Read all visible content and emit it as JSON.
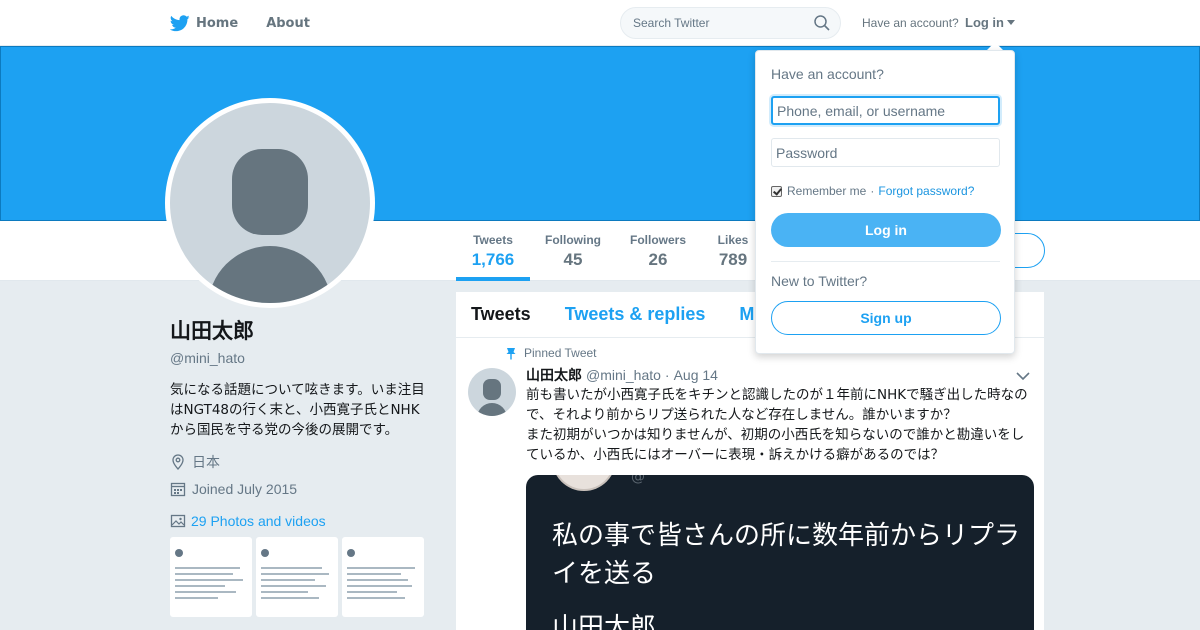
{
  "nav": {
    "home_label": "Home",
    "about_label": "About",
    "search_placeholder": "Search Twitter",
    "have_account": "Have an account?",
    "login_label": "Log in"
  },
  "profile": {
    "name": "山田太郎",
    "handle": "@mini_hato",
    "bio": "気になる話題について呟きます。いま注目はNGT48の行く末と、小西寛子氏とNHKから国民を守る党の今後の展開です。",
    "location": "日本",
    "joined": "Joined July 2015",
    "photos_label": "29 Photos and videos"
  },
  "stats": [
    {
      "label": "Tweets",
      "value": "1,766"
    },
    {
      "label": "Following",
      "value": "45"
    },
    {
      "label": "Followers",
      "value": "26"
    },
    {
      "label": "Likes",
      "value": "789"
    }
  ],
  "timeline": {
    "tabs": [
      "Tweets",
      "Tweets & replies",
      "M"
    ],
    "pinned_label": "Pinned Tweet",
    "tweet": {
      "name": "山田太郎",
      "handle": "@mini_hato",
      "separator": "·",
      "date": "Aug 14",
      "text": "前も書いたが小西寛子氏をキチンと認識したのが１年前にNHKで騒ぎ出した時なので、それより前からリプ送られた人など存在しません。誰かいますか？\nまた初期がいつかは知りませんが、初期の小西氏を知らないので誰かと勘違いをしているか、小西氏にはオーバーに表現・訴えかける癖があるのでは？",
      "media_text": "私の事で皆さんの所に数年前からリプライを送る",
      "media_name": "山田太郎"
    }
  },
  "login_dropdown": {
    "title": "Have an account?",
    "username_placeholder": "Phone, email, or username",
    "password_placeholder": "Password",
    "remember_label": "Remember me",
    "separator": "·",
    "forgot_label": "Forgot password?",
    "login_button": "Log in",
    "new_label": "New to Twitter?",
    "signup_button": "Sign up"
  },
  "colors": {
    "brand_blue": "#1da1f2",
    "banner": "#1da1f2",
    "background": "#e6ecf0"
  }
}
